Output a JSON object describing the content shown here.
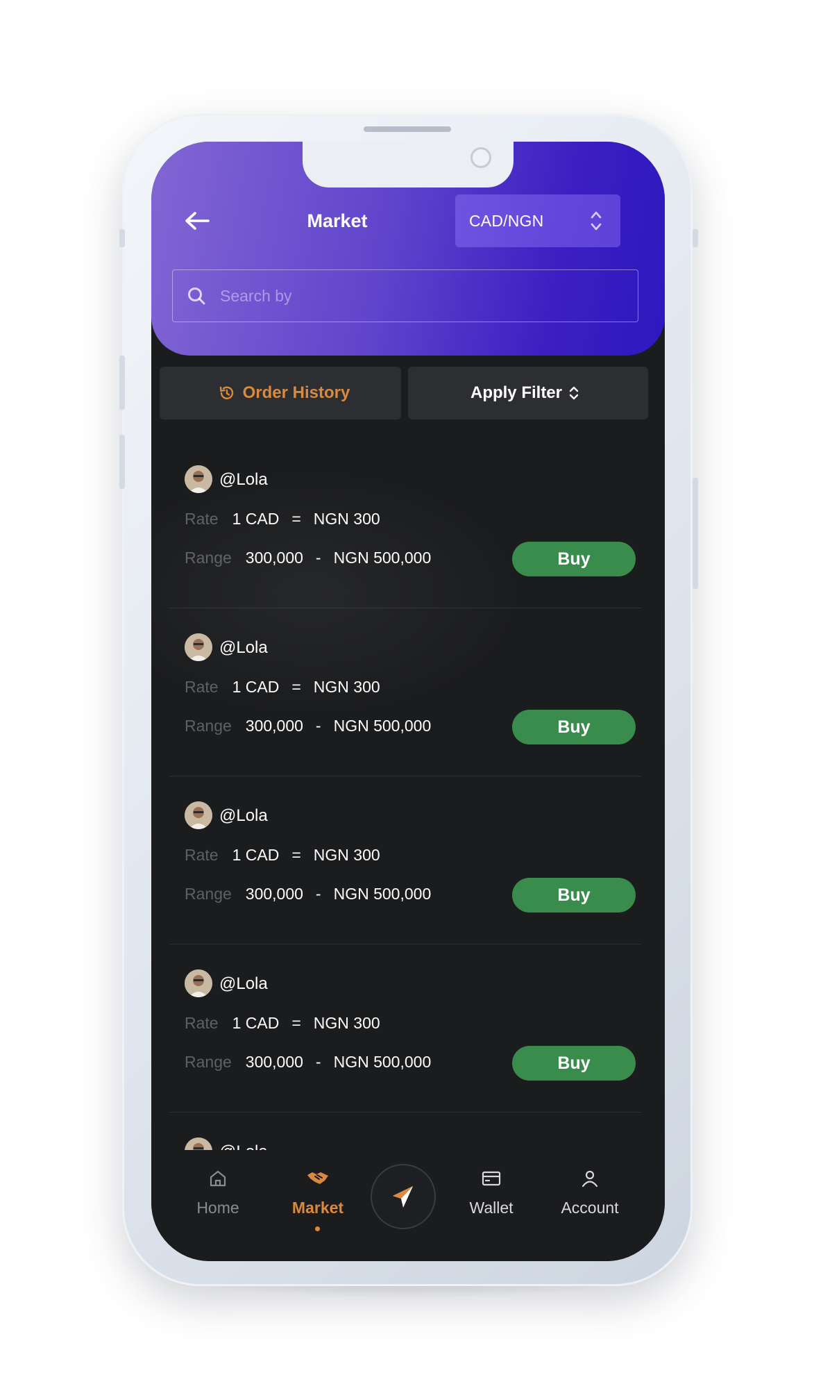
{
  "header": {
    "title": "Market",
    "pair_selector": "CAD/NGN",
    "search_placeholder": "Search by"
  },
  "actions": {
    "order_history": "Order History",
    "apply_filter": "Apply Filter"
  },
  "offers": [
    {
      "username": "@Lola",
      "rate_label": "Rate",
      "rate_from": "1 CAD",
      "rate_eq": "=",
      "rate_to": "NGN 300",
      "range_label": "Range",
      "range_min": "300,000",
      "range_sep": "-",
      "range_max": "NGN 500,000",
      "buy_label": "Buy"
    },
    {
      "username": "@Lola",
      "rate_label": "Rate",
      "rate_from": "1 CAD",
      "rate_eq": "=",
      "rate_to": "NGN 300",
      "range_label": "Range",
      "range_min": "300,000",
      "range_sep": "-",
      "range_max": "NGN 500,000",
      "buy_label": "Buy"
    },
    {
      "username": "@Lola",
      "rate_label": "Rate",
      "rate_from": "1 CAD",
      "rate_eq": "=",
      "rate_to": "NGN 300",
      "range_label": "Range",
      "range_min": "300,000",
      "range_sep": "-",
      "range_max": "NGN 500,000",
      "buy_label": "Buy"
    },
    {
      "username": "@Lola",
      "rate_label": "Rate",
      "rate_from": "1 CAD",
      "rate_eq": "=",
      "rate_to": "NGN 300",
      "range_label": "Range",
      "range_min": "300,000",
      "range_sep": "-",
      "range_max": "NGN 500,000",
      "buy_label": "Buy"
    },
    {
      "username": "@Lola"
    }
  ],
  "bottom_nav": {
    "items": [
      {
        "label": "Home",
        "icon": "home-icon"
      },
      {
        "label": "Market",
        "icon": "handshake-icon",
        "active": true
      },
      {
        "label": "Wallet",
        "icon": "wallet-icon"
      },
      {
        "label": "Account",
        "icon": "user-icon"
      }
    ],
    "center_icon": "compass-icon"
  },
  "colors": {
    "header_gradient_start": "#8366d4",
    "header_gradient_end": "#2e18bd",
    "accent_orange": "#d98a3e",
    "buy_green": "#3a8c4c",
    "background": "#1b1c1e"
  }
}
